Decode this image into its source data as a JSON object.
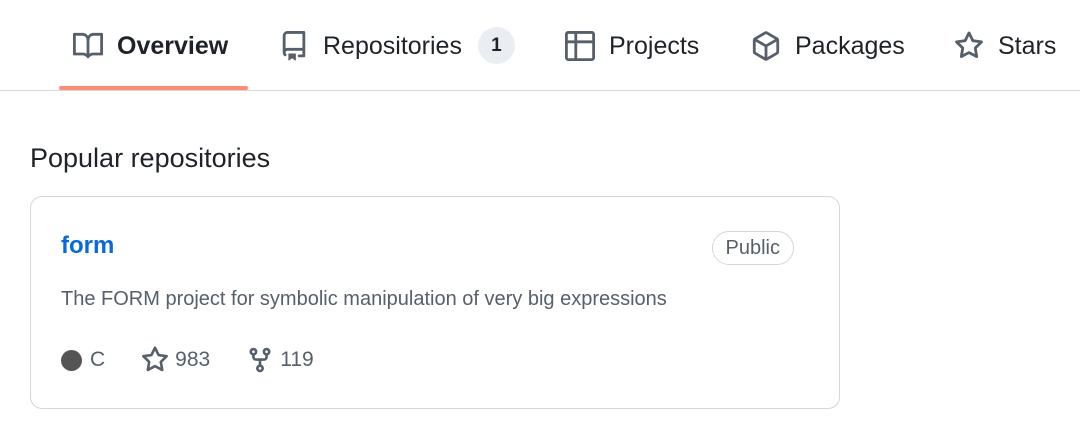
{
  "tabs": [
    {
      "label": "Overview",
      "icon": "book-icon",
      "selected": true
    },
    {
      "label": "Repositories",
      "icon": "repo-icon",
      "counter": "1"
    },
    {
      "label": "Projects",
      "icon": "table-icon"
    },
    {
      "label": "Packages",
      "icon": "package-icon"
    },
    {
      "label": "Stars",
      "icon": "star-icon"
    }
  ],
  "popular": {
    "title": "Popular repositories",
    "repos": [
      {
        "name": "form",
        "visibility": "Public",
        "description": "The FORM project for symbolic manipulation of very big expressions",
        "language": "C",
        "language_color": "#555555",
        "stars": "983",
        "forks": "119"
      }
    ]
  },
  "colors": {
    "accent_underline": "#fd8c73",
    "link": "#0969da",
    "muted_text": "#57606a",
    "border": "#d0d7de"
  }
}
